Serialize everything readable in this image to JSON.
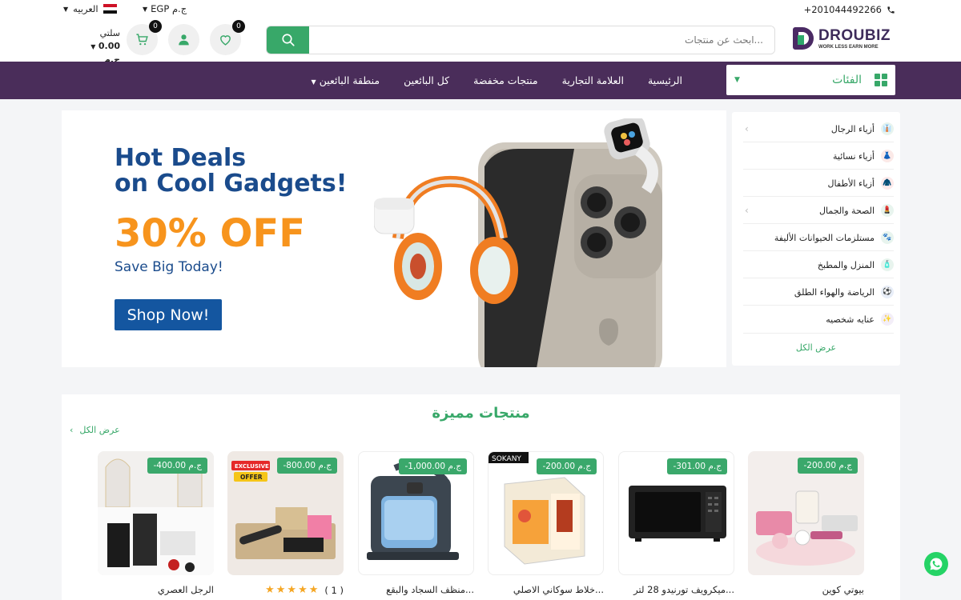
{
  "topbar": {
    "phone": "+201044492266",
    "language": "العربيه",
    "currency": "EGP ج.م"
  },
  "header": {
    "logo_main": "DROUBIZ",
    "logo_tagline": "WORK LESS EARN MORE",
    "search_placeholder": "ابحث عن منتجات...",
    "wishlist_count": "0",
    "cart_count": "0",
    "cart_label": "سلتي",
    "cart_total": "0.00 ج.م"
  },
  "nav": {
    "categories_label": "الفئات",
    "items": [
      "الرئيسية",
      "العلامة التجارية",
      "منتجات مخفضة",
      "كل البائعين",
      "منطقة البائعين"
    ]
  },
  "sidebar": {
    "items": [
      {
        "label": "أزياء الرجال",
        "has_arrow": true
      },
      {
        "label": "أزياء نسائية",
        "has_arrow": false
      },
      {
        "label": "أزياء الأطفال",
        "has_arrow": false
      },
      {
        "label": "الصحة والجمال",
        "has_arrow": true
      },
      {
        "label": "مستلزمات الحيوانات الأليفة",
        "has_arrow": false
      },
      {
        "label": "المنزل والمطبخ",
        "has_arrow": false
      },
      {
        "label": "الرياضة والهواء الطلق",
        "has_arrow": false
      },
      {
        "label": "عنايه شخصيه",
        "has_arrow": false
      }
    ],
    "view_all": "عرض الكل"
  },
  "banner": {
    "line1": "Hot Deals",
    "line2": "on Cool Gadgets!",
    "discount": "30% OFF",
    "subtitle": "Save Big Today!",
    "cta": "Shop Now!"
  },
  "featured": {
    "title": "منتجات مميزة",
    "view_all": "عرض الكل",
    "products": [
      {
        "price": "ج.م 200.00-",
        "name": "بيوتي كوين"
      },
      {
        "price": "ج.م 301.00-",
        "name": "ميكرويف تورنيدو 28 لتر..."
      },
      {
        "price": "ج.م 200.00-",
        "name": "خلاط سوكاني الاصلي..."
      },
      {
        "price": "ج.م 1,000.00-",
        "name": "منظف السجاد والبقع..."
      },
      {
        "price": "ج.م 800.00-",
        "name": "",
        "rating_count": "( 1 )",
        "stars": 5,
        "tag_line1": "EXCLUSIVE",
        "tag_line2": "OFFER"
      },
      {
        "price": "ج.م 400.00-",
        "name": "الرجل العصري"
      }
    ],
    "box_brand": "SOKANY"
  },
  "colors": {
    "primary_green": "#38a869",
    "nav_purple": "#4a2d5a",
    "banner_blue": "#1a4b8c",
    "banner_orange": "#f7941d"
  }
}
